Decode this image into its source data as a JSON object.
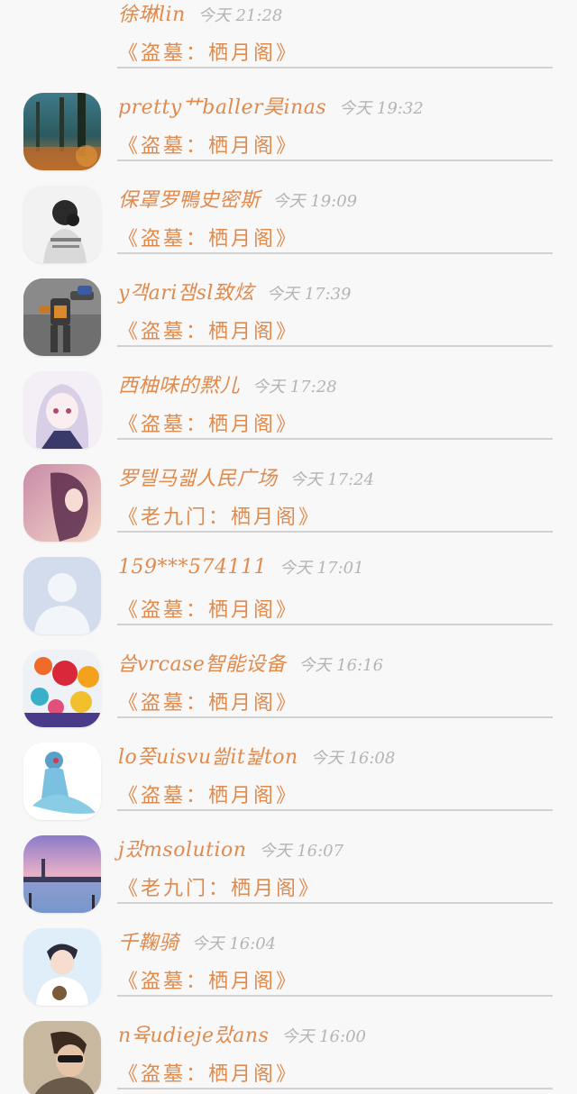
{
  "messages": [
    {
      "name": "徐琳lin",
      "time": "今天 21:28",
      "text": "《盗墓：栖月阁》",
      "avatar_icon": "none"
    },
    {
      "name": "pretty艹baller昊inas",
      "time": "今天 19:32",
      "text": "《盗墓：栖月阁》",
      "avatar_icon": "forest-photo"
    },
    {
      "name": "保罩罗鴨史密斯",
      "time": "今天 19:09",
      "text": "《盗墓：栖月阁》",
      "avatar_icon": "girl-bw-photo"
    },
    {
      "name": "y객ari잼sl致炫",
      "time": "今天 17:39",
      "text": "《盗墓：栖月阁》",
      "avatar_icon": "robot-photo"
    },
    {
      "name": "西柚味的黙儿",
      "time": "今天 17:28",
      "text": "《盗墓：栖月阁》",
      "avatar_icon": "anime-girl-photo"
    },
    {
      "name": "罗텔马괣人民广场",
      "time": "今天 17:24",
      "text": "《老九门：栖月阁》",
      "avatar_icon": "pink-girl-photo"
    },
    {
      "name": "159***574111",
      "time": "今天 17:01",
      "text": "《盗墓：栖月阁》",
      "avatar_icon": "default-user-icon"
    },
    {
      "name": "씁vrcase智能设备",
      "time": "今天 16:16",
      "text": "《盗墓：栖月阁》",
      "avatar_icon": "balloons-photo"
    },
    {
      "name": "lo쫒uisvu씖it눭ton",
      "time": "今天 16:08",
      "text": "《盗墓：栖月阁》",
      "avatar_icon": "pokemon-photo"
    },
    {
      "name": "j괐msolution",
      "time": "今天 16:07",
      "text": "《老九门：栖月阁》",
      "avatar_icon": "venice-photo"
    },
    {
      "name": "千鞠骑",
      "time": "今天 16:04",
      "text": "《盗墓：栖月阁》",
      "avatar_icon": "boy-photo"
    },
    {
      "name": "n육udieje랐ans",
      "time": "今天 16:00",
      "text": "《盗墓：栖月阁》",
      "avatar_icon": "man-sunglasses-photo"
    }
  ]
}
